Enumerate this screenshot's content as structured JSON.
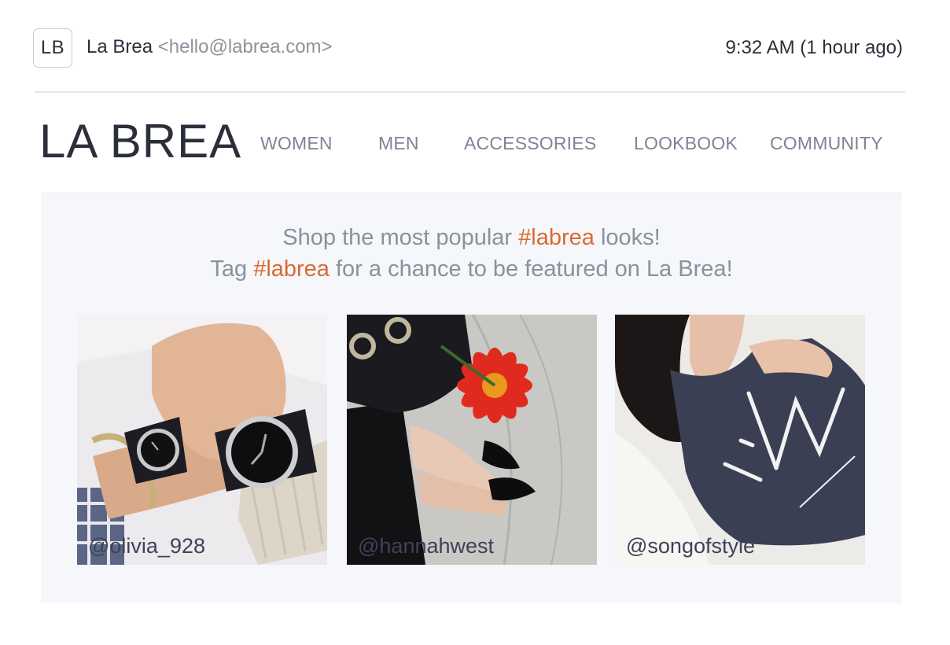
{
  "email": {
    "avatar_initials": "LB",
    "sender_name": "La Brea",
    "sender_email": "<hello@labrea.com>",
    "timestamp": "9:32 AM (1 hour ago)"
  },
  "brand": {
    "logo": "LA BREA",
    "nav": [
      "WOMEN",
      "MEN",
      "ACCESSORIES",
      "LOOKBOOK",
      "COMMUNITY"
    ]
  },
  "featured": {
    "line1_prefix": "Shop the most popular ",
    "line1_hashtag": "#labrea",
    "line1_suffix": " looks!",
    "line2_prefix": "Tag ",
    "line2_hashtag": "#labrea",
    "line2_suffix": " for a chance to be featured on La Brea!",
    "hashtag_color": "#d96a33",
    "photos": [
      {
        "handle": "@olivia_928",
        "icon": "watches-photo"
      },
      {
        "handle": "@hannahwest",
        "icon": "flower-heels-photo"
      },
      {
        "handle": "@songofstyle",
        "icon": "tshirt-photo"
      }
    ]
  }
}
